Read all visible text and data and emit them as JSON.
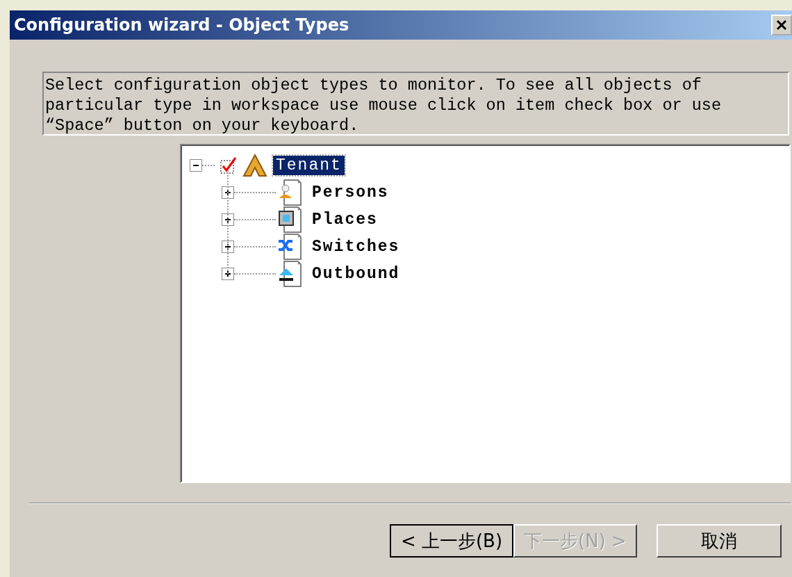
{
  "window": {
    "title": "Configuration wizard - Object Types"
  },
  "description": "Select configuration object types to monitor. To see all objects of particular type in workspace use mouse click on item check box or use “Space” button on your keyboard.",
  "tree": [
    {
      "label": "Tenant",
      "kind": "tenant",
      "checked": true,
      "selected": true,
      "expanded": true,
      "children": [
        {
          "label": "Persons",
          "kind": "person",
          "selected": false,
          "expanded": false
        },
        {
          "label": "Places",
          "kind": "place",
          "selected": false,
          "expanded": false
        },
        {
          "label": "Switches",
          "kind": "switch",
          "selected": false,
          "expanded": false
        },
        {
          "label": "Outbound",
          "kind": "outbound",
          "selected": false,
          "expanded": false
        }
      ]
    }
  ],
  "buttons": [
    {
      "label": "< 上一步(B)",
      "disabled": false,
      "default": true
    },
    {
      "label": "下一步(N) >",
      "disabled": true,
      "default": false
    },
    {
      "label": "取消",
      "disabled": false,
      "default": false
    }
  ]
}
